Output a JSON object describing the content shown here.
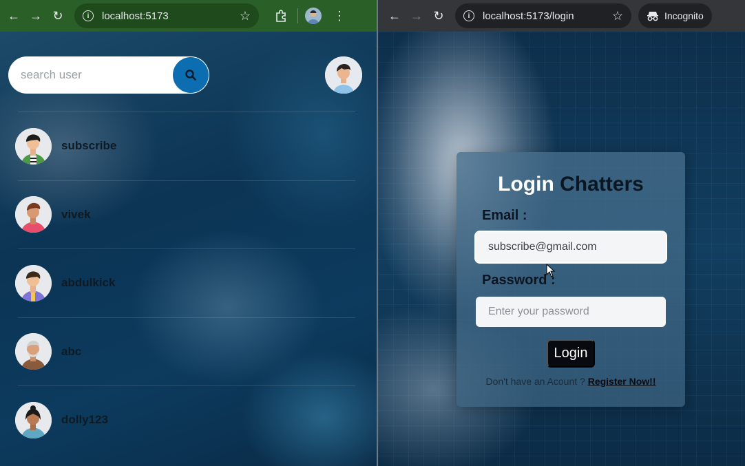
{
  "left_window": {
    "toolbar": {
      "url": "localhost:5173"
    },
    "search": {
      "placeholder": "search user"
    },
    "users": [
      {
        "name": "subscribe",
        "avatar": "avatar-subscribe"
      },
      {
        "name": "vivek",
        "avatar": "avatar-vivek"
      },
      {
        "name": "abdulkick",
        "avatar": "avatar-abdulkick"
      },
      {
        "name": "abc",
        "avatar": "avatar-abc"
      },
      {
        "name": "dolly123",
        "avatar": "avatar-dolly123"
      }
    ]
  },
  "right_window": {
    "toolbar": {
      "url": "localhost:5173/login",
      "incognito_label": "Incognito"
    },
    "login": {
      "title_part1": "Login",
      "title_part2": "Chatters",
      "email_label": "Email :",
      "email_value": "subscribe@gmail.com",
      "password_label": "Password :",
      "password_placeholder": "Enter your password",
      "button_label": "Login",
      "register_prompt": "Don't have an Acount ?",
      "register_link": "Register Now!!"
    }
  },
  "colors": {
    "left_toolbar": "#2b5f28",
    "right_toolbar": "#35363a",
    "search_button": "#0c6db0",
    "login_button": "#070b10"
  }
}
